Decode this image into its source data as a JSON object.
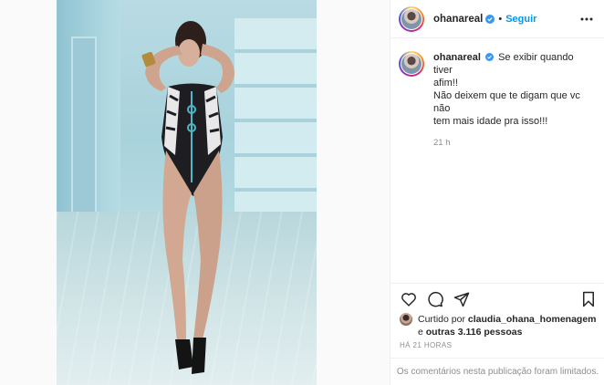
{
  "colors": {
    "accent": "#0095f6",
    "muted": "#8e8e8e",
    "text": "#262626",
    "verified": "#3897f0"
  },
  "post": {
    "author": {
      "username": "ohanareal",
      "verified": true
    },
    "header": {
      "separator": "•",
      "follow_label": "Seguir",
      "more_icon": "more-horizontal-icon"
    },
    "caption": {
      "username": "ohanareal",
      "lines": [
        "Se exibir quando tiver",
        "afim!!",
        "Não deixem que te digam que vc não",
        "tem mais idade pra isso!!!"
      ],
      "relative_time": "21 h"
    },
    "actions": [
      "heart-icon",
      "comment-icon",
      "share-icon",
      "bookmark-icon"
    ],
    "likes": {
      "prefix": "Curtido por",
      "liker": "claudia_ohana_homenagem",
      "connector": "e",
      "others": "outras 3.116 pessoas"
    },
    "timestamp": "HÁ 21 HORAS",
    "comments_limited": "Os comentários nesta publicação foram limitados."
  }
}
